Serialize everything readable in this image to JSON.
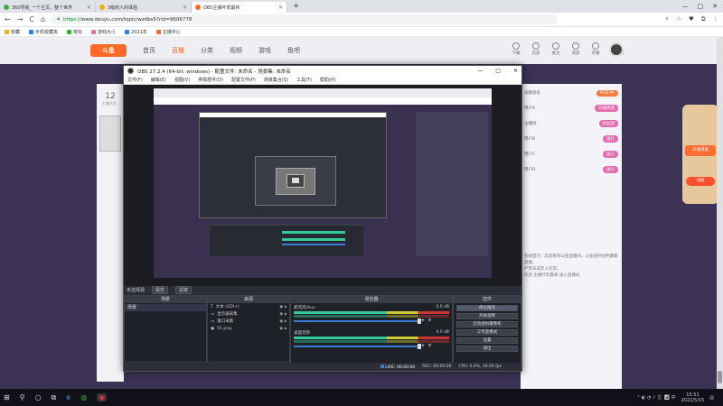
{
  "browser": {
    "tabs": [
      {
        "label": "360导航_一个主页，整个世界",
        "favicon_color": "#3fae49",
        "active": false
      },
      {
        "label": "3级的人的体验",
        "favicon_color": "#f0b400",
        "active": false
      },
      {
        "label": "OBS主播叶凯最帅",
        "favicon_color": "#ff6a28",
        "active": true
      }
    ],
    "new_tab": "+",
    "window_controls": [
      "—",
      "□",
      "✕"
    ],
    "nav": {
      "back": "←",
      "forward": "→",
      "reload": "C",
      "home": "⌂"
    },
    "url": {
      "protocol": "https://",
      "rest": "www.douyu.com/topic/wzdbs5?rid=9606778"
    },
    "ext_icons": [
      "⚡",
      "☆",
      "♥",
      "⧉",
      "⋮"
    ],
    "bookmarks": [
      {
        "label": "收藏",
        "color": "#f0b400"
      },
      {
        "label": "手机收藏夹",
        "color": "#3a7bd5"
      },
      {
        "label": "常玩",
        "color": "#3fae49"
      },
      {
        "label": "游戏大小",
        "color": "#e56ab0"
      },
      {
        "label": "2021年",
        "color": "#3a7bd5"
      },
      {
        "label": "主播中心",
        "color": "#ff6a28"
      }
    ]
  },
  "douyu": {
    "logo": "斗鱼",
    "nav": [
      "首页",
      "直播",
      "分类",
      "视频",
      "游戏",
      "鱼吧"
    ],
    "nav_active": 1,
    "head_icons": [
      "下载",
      "历史",
      "关注",
      "消息",
      "开播",
      "客户端"
    ],
    "room_number": "12",
    "room_sub": "主播叶凯..",
    "right_panel_rows": [
      {
        "label": "贡献排名",
        "pill": "PCB PK"
      },
      {
        "label": "用户A",
        "pill": "开通贵族"
      },
      {
        "label": "主播榜",
        "pill": "粉丝团"
      },
      {
        "label": "用户B",
        "pill": "送礼"
      },
      {
        "label": "用户C",
        "pill": "送礼"
      },
      {
        "label": "用户D",
        "pill": "送礼"
      }
    ],
    "chat_lines": [
      "系统提示：欢迎来到斗鱼直播间，斗鱼倡导绿色健康直播，",
      "严禁未成年人打赏。",
      "欢迎 主播叶凯最帅 进入直播间"
    ],
    "side_banner": {
      "btn1": "开通贵族",
      "btn2": "领取"
    }
  },
  "obs": {
    "title": "OBS 27.2.4 (64-bit, windows) - 配置文件: 未命名 - 场景集: 未命名",
    "window_controls": [
      "—",
      "□",
      "✕"
    ],
    "menu": [
      "文件(F)",
      "编辑(E)",
      "视图(V)",
      "停靠部件(D)",
      "配置文件(P)",
      "场景集合(S)",
      "工具(T)",
      "帮助(H)"
    ],
    "label_row": {
      "left": "未选择源",
      "btn1": "属性",
      "btn2": "滤镜"
    },
    "docks": {
      "scenes": {
        "title": "场景",
        "items": [
          "场景"
        ]
      },
      "sources": {
        "title": "来源",
        "items": [
          {
            "label": "文本 (GDI+)",
            "icon": "T"
          },
          {
            "label": "显示器采集",
            "icon": "▭"
          },
          {
            "label": "窗口采集",
            "icon": "▭"
          },
          {
            "label": "01.png",
            "icon": "▣"
          }
        ]
      },
      "mixer": {
        "title": "混音器",
        "channels": [
          {
            "name": "麦克风/Aux",
            "value": "0.0 dB"
          },
          {
            "name": "桌面音频",
            "value": "0.0 dB"
          }
        ]
      },
      "controls": {
        "title": "控件",
        "buttons": [
          "停止推流",
          "开始录制",
          "启动虚拟摄像机",
          "工作室模式",
          "设置",
          "退出"
        ]
      }
    },
    "footer_icons": [
      "+",
      "—",
      "⌃",
      "⌄"
    ],
    "status": {
      "live": "LIVE: 00:00:00",
      "rec": "REC: 00:00:00",
      "cpu": "CPU: 0.4%, 30.00 fps"
    }
  },
  "taskbar": {
    "apps": [
      {
        "name": "windows-start",
        "glyph": "⊞"
      },
      {
        "name": "search",
        "glyph": "⚲"
      },
      {
        "name": "cortana",
        "glyph": "○"
      },
      {
        "name": "task-view",
        "glyph": "⧉"
      },
      {
        "name": "edge",
        "glyph": "e"
      },
      {
        "name": "browser-360",
        "glyph": "◍"
      },
      {
        "name": "obs",
        "glyph": "◉"
      }
    ],
    "time": "15:51",
    "date": "2022/5/15"
  }
}
